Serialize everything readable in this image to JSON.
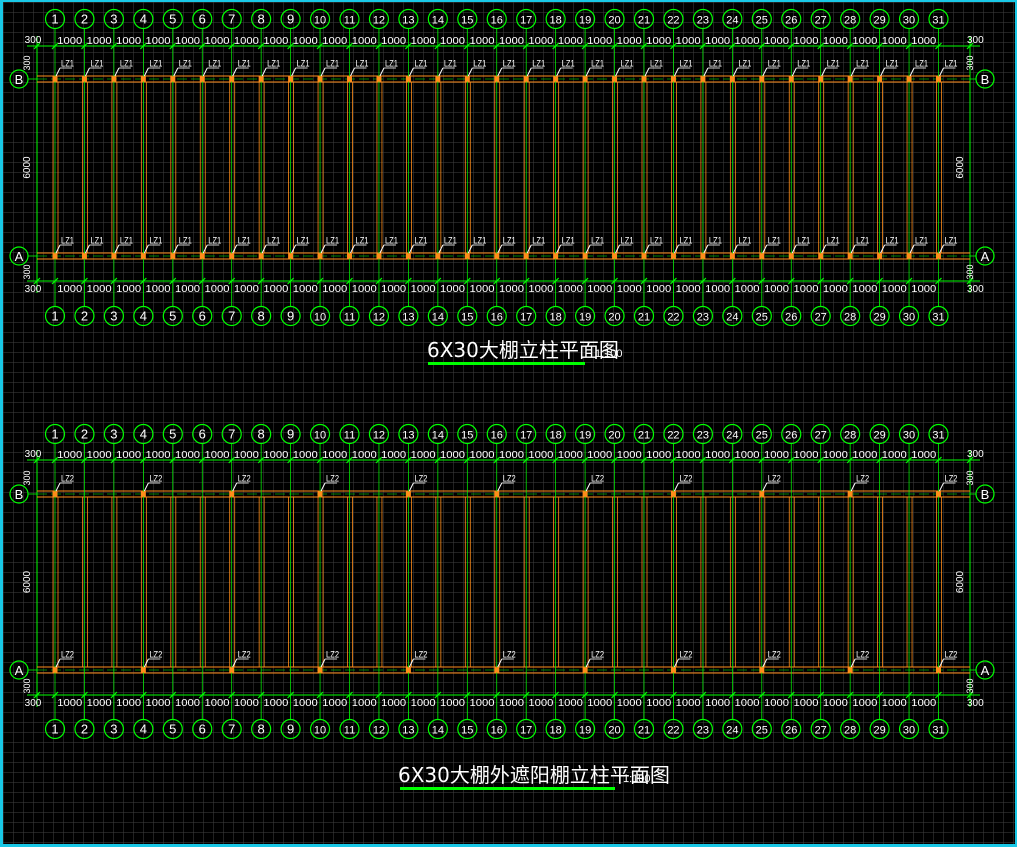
{
  "colors": {
    "background": "#000000",
    "grid": "#3c3c3c",
    "border": "#19c8e6",
    "axis": "#00ff00",
    "dimension": "#00ff00",
    "column": "#ff8c1a",
    "dim_text": "#ffffff",
    "bubble_text": "#ffffff",
    "column_label": "#ffffff",
    "title_text": "#ffffff",
    "title_underline": "#00ff00"
  },
  "plans": [
    {
      "id": "plan-1",
      "title": "6X30大棚立柱平面图",
      "scale": "1:100",
      "column_label": "LZ1",
      "column_every": 1,
      "column_axes": [
        "1",
        "2",
        "3",
        "4",
        "5",
        "6",
        "7",
        "8",
        "9",
        "10",
        "11",
        "12",
        "13",
        "14",
        "15",
        "16",
        "17",
        "18",
        "19",
        "20",
        "21",
        "22",
        "23",
        "24",
        "25",
        "26",
        "27",
        "28",
        "29",
        "30",
        "31"
      ],
      "axis_numbers": [
        "1",
        "2",
        "3",
        "4",
        "5",
        "6",
        "7",
        "8",
        "9",
        "10",
        "11",
        "12",
        "13",
        "14",
        "15",
        "16",
        "17",
        "18",
        "19",
        "20",
        "21",
        "22",
        "23",
        "24",
        "25",
        "26",
        "27",
        "28",
        "29",
        "30",
        "31"
      ],
      "span_dims": [
        "1000",
        "1000",
        "1000",
        "1000",
        "1000",
        "1000",
        "1000",
        "1000",
        "1000",
        "1000",
        "1000",
        "1000",
        "1000",
        "1000",
        "1000",
        "1000",
        "1000",
        "1000",
        "1000",
        "1000",
        "1000",
        "1000",
        "1000",
        "1000",
        "1000",
        "1000",
        "1000",
        "1000",
        "1000",
        "1000"
      ],
      "edge_dim": "300",
      "row_labels": [
        "B",
        "A"
      ],
      "depth_dim": "6000",
      "offset_dim": "300"
    },
    {
      "id": "plan-2",
      "title": "6X30大棚外遮阳棚立柱平面图",
      "scale": "1:100",
      "column_label": "LZ2",
      "column_every": 3,
      "column_axes": [
        "1",
        "4",
        "7",
        "10",
        "13",
        "16",
        "19",
        "22",
        "25",
        "28",
        "31"
      ],
      "axis_numbers": [
        "1",
        "2",
        "3",
        "4",
        "5",
        "6",
        "7",
        "8",
        "9",
        "10",
        "11",
        "12",
        "13",
        "14",
        "15",
        "16",
        "17",
        "18",
        "19",
        "20",
        "21",
        "22",
        "23",
        "24",
        "25",
        "26",
        "27",
        "28",
        "29",
        "30",
        "31"
      ],
      "span_dims": [
        "1000",
        "1000",
        "1000",
        "1000",
        "1000",
        "1000",
        "1000",
        "1000",
        "1000",
        "1000",
        "1000",
        "1000",
        "1000",
        "1000",
        "1000",
        "1000",
        "1000",
        "1000",
        "1000",
        "1000",
        "1000",
        "1000",
        "1000",
        "1000",
        "1000",
        "1000",
        "1000",
        "1000",
        "1000",
        "1000"
      ],
      "edge_dim": "300",
      "row_labels": [
        "B",
        "A"
      ],
      "depth_dim": "6000",
      "offset_dim": "300"
    }
  ]
}
